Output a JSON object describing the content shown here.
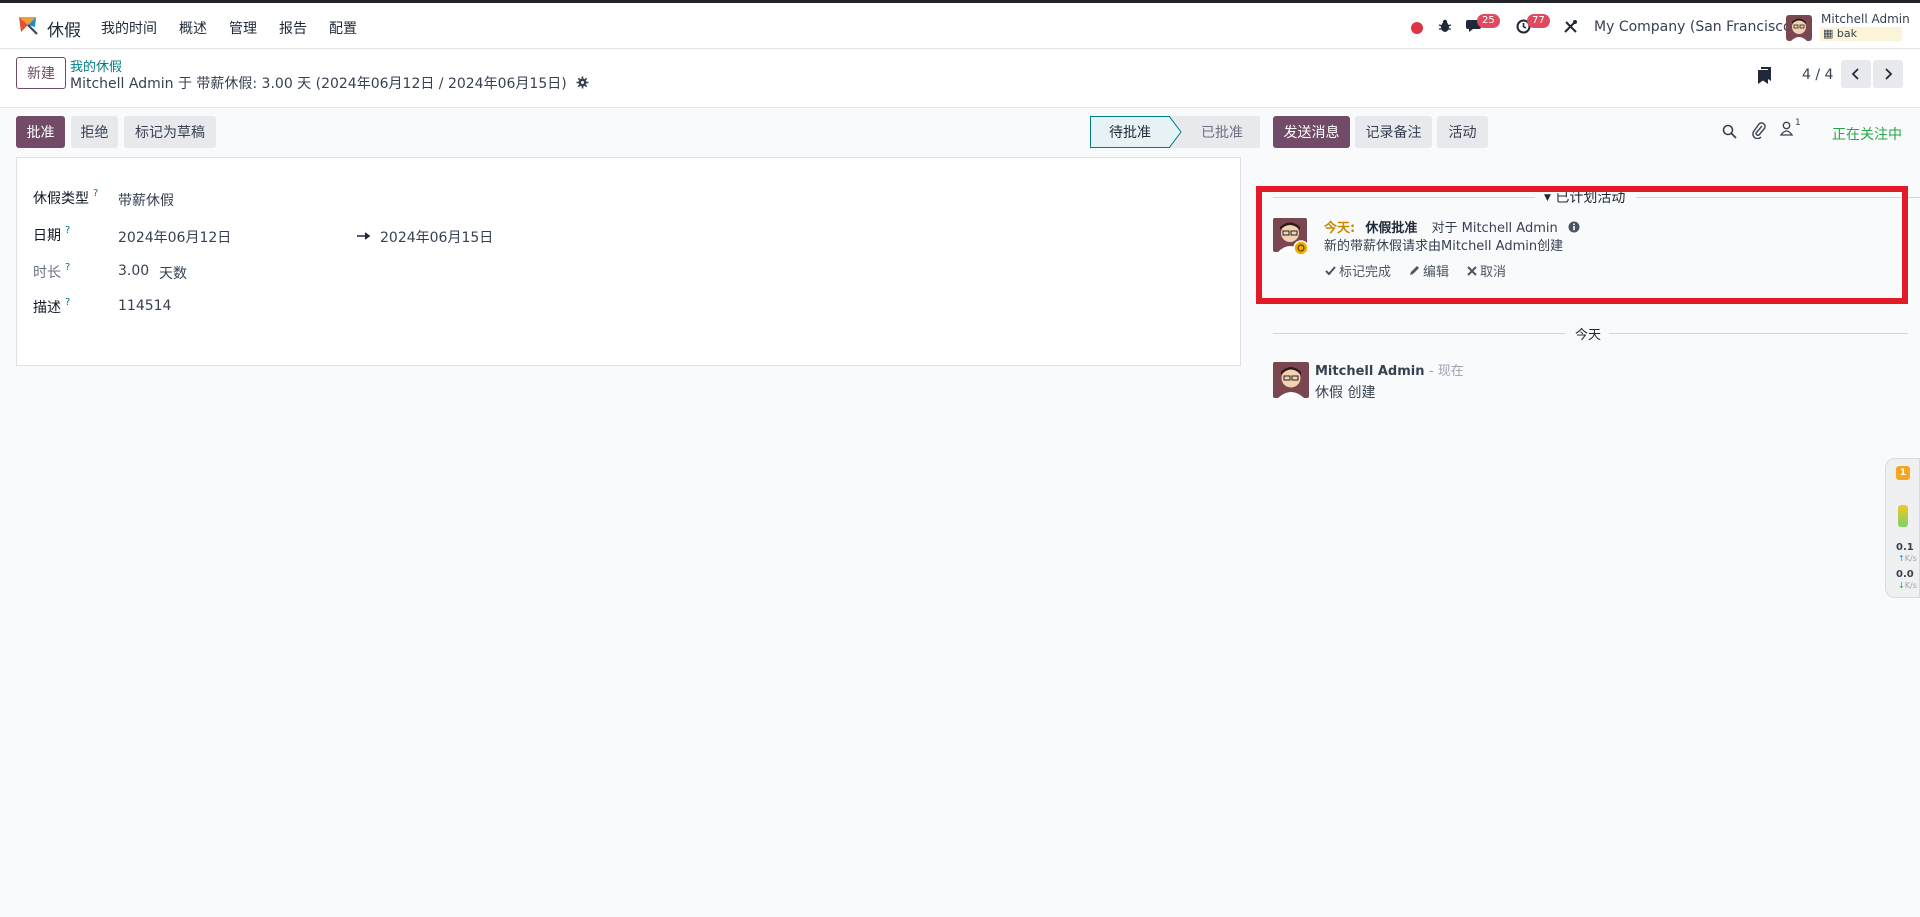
{
  "navbar": {
    "app_name": "休假",
    "menu": [
      "我的时间",
      "概述",
      "管理",
      "报告",
      "配置"
    ],
    "chat_badge": "25",
    "activity_badge": "77",
    "company": "My Company (San Francisco)",
    "user_name": "Mitchell Admin",
    "database": "bak"
  },
  "control_panel": {
    "new_label": "新建",
    "breadcrumb_parent": "我的休假",
    "breadcrumb_current": "Mitchell Admin 于 带薪休假: 3.00 天 (2024年06月12日 / 2024年06月15日)",
    "pager": "4 / 4"
  },
  "form": {
    "buttons": {
      "approve": "批准",
      "refuse": "拒绝",
      "draft": "标记为草稿"
    },
    "stages": {
      "active": "待批准",
      "inactive": "已批准"
    },
    "fields": {
      "leave_type_label": "休假类型",
      "leave_type_value": "带薪休假",
      "date_label": "日期",
      "date_from": "2024年06月12日",
      "date_to": "2024年06月15日",
      "duration_label": "时长",
      "duration_value": "3.00",
      "duration_unit": "天数",
      "description_label": "描述",
      "description_value": "114514",
      "help_mark": "?"
    }
  },
  "chatter": {
    "send_message": "发送消息",
    "log_note": "记录备注",
    "activities": "活动",
    "followers_count": "1",
    "following": "正在关注中",
    "planned_title": "已计划活动",
    "activity": {
      "today": "今天:",
      "type": "休假批准",
      "for": "对于 Mitchell Admin",
      "summary": "新的带薪休假请求由Mitchell Admin创建",
      "mark_done": "标记完成",
      "edit": "编辑",
      "cancel": "取消"
    },
    "date_separator": "今天",
    "message": {
      "author": "Mitchell Admin",
      "time": "- 现在",
      "body": "休假 创建"
    }
  },
  "side_widget": {
    "alert_count": "1",
    "up_value": "0.1",
    "down_value": "0.0",
    "unit": "K/s"
  }
}
